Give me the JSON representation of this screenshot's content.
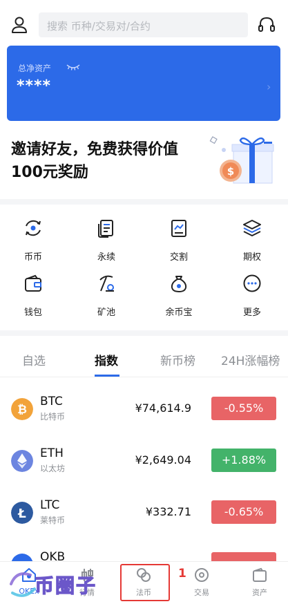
{
  "search": {
    "placeholder": "搜索 币种/交易对/合约"
  },
  "asset": {
    "label": "总净资产",
    "value": "****"
  },
  "promo": {
    "title": "邀请好友，免费获得价值100元奖励"
  },
  "grid": {
    "items": [
      {
        "label": "币币"
      },
      {
        "label": "永续"
      },
      {
        "label": "交割"
      },
      {
        "label": "期权"
      },
      {
        "label": "钱包"
      },
      {
        "label": "矿池"
      },
      {
        "label": "余币宝"
      },
      {
        "label": "更多"
      }
    ]
  },
  "tabs": [
    {
      "label": "自选"
    },
    {
      "label": "指数"
    },
    {
      "label": "新币榜"
    },
    {
      "label": "24H涨幅榜"
    }
  ],
  "tickers": [
    {
      "symbol": "BTC",
      "name": "比特币",
      "price": "¥74,614.9",
      "change": "-0.55%",
      "color": "#e86466"
    },
    {
      "symbol": "ETH",
      "name": "以太坊",
      "price": "¥2,649.04",
      "change": "+1.88%",
      "color": "#43b36a"
    },
    {
      "symbol": "LTC",
      "name": "莱特币",
      "price": "¥332.71",
      "change": "-0.65%",
      "color": "#e86466"
    },
    {
      "symbol": "OKB",
      "name": "",
      "price": "",
      "change": "",
      "color": "#e86466"
    }
  ],
  "bottom_nav": [
    {
      "label": "OKEx"
    },
    {
      "label": "行情"
    },
    {
      "label": "法币"
    },
    {
      "label": "交易"
    },
    {
      "label": "资产"
    }
  ],
  "annotation": {
    "number": "1"
  },
  "watermark": {
    "text": "币圈子"
  },
  "colors": {
    "accent": "#2c6ae8",
    "down": "#e86466",
    "up": "#43b36a",
    "highlight": "#e53935"
  }
}
